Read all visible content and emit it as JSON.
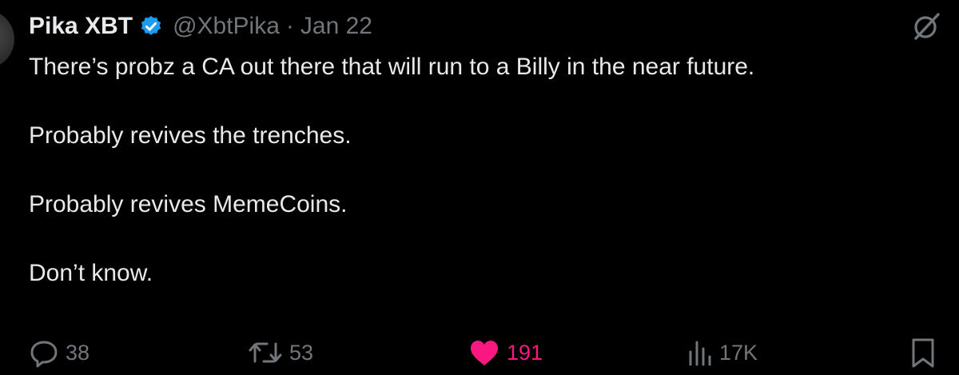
{
  "tweet": {
    "author_name": "Pika XBT",
    "handle": "@XbtPika",
    "separator": "·",
    "date": "Jan 22",
    "lines": [
      "There’s probz a CA out there that will run to a Billy in the near future.",
      "Probably revives the trenches.",
      "Probably revives MemeCoins.",
      "Don’t know."
    ]
  },
  "actions": {
    "replies": "38",
    "reposts": "53",
    "likes": "191",
    "views": "17K"
  },
  "icons": {
    "verified": "verified-badge-icon",
    "grok": "grok-icon",
    "reply": "reply-icon",
    "repost": "repost-icon",
    "like": "heart-icon",
    "views": "views-icon",
    "bookmark": "bookmark-icon"
  },
  "colors": {
    "background": "#000000",
    "text": "#e7e9ea",
    "muted": "#71767b",
    "verified": "#1d9bf0",
    "like": "#f91880"
  }
}
